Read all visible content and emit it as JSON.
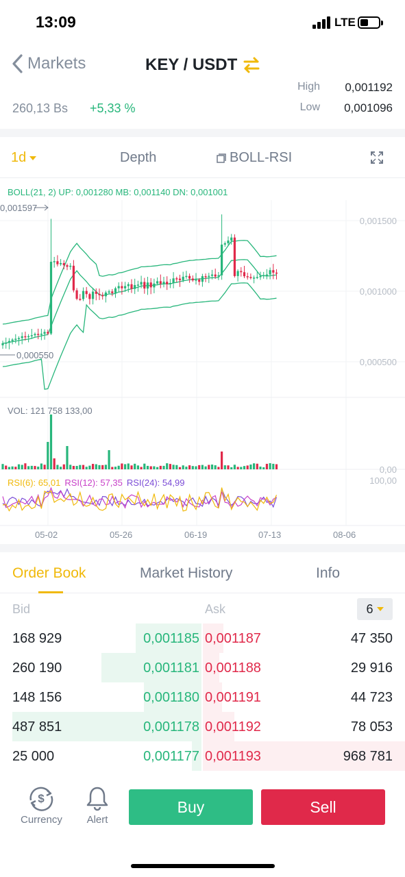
{
  "status_bar": {
    "time": "13:09",
    "carrier": "LTE"
  },
  "nav": {
    "back_label": "Markets",
    "pair": "KEY / USDT"
  },
  "price": {
    "local_value": "260,13 Bs",
    "change": "+5,33 %",
    "high_label": "High",
    "high_value": "0,001192",
    "low_label": "Low",
    "low_value": "0,001096"
  },
  "chart_tabs": {
    "interval": "1d",
    "depth": "Depth",
    "indicator": "BOLL-RSI"
  },
  "chart": {
    "boll_legend": "BOLL(21, 2) UP: 0,001280 MB: 0,001140 DN: 0,001001",
    "vol_legend": "VOL: 121 758 133,00",
    "rsi6": "RSI(6): 65,01",
    "rsi12": "RSI(12): 57,35",
    "rsi24": "RSI(24): 54,99",
    "y_ticks": [
      "0,001500",
      "0,001000",
      "0,000500"
    ],
    "vol_zero": "0,00",
    "rsi_top": "100,00",
    "high_marker": "0,001597",
    "low_marker": "0,000550",
    "x_ticks": [
      "05-02",
      "05-26",
      "06-19",
      "07-13",
      "08-06"
    ]
  },
  "orderbook": {
    "tabs": [
      "Order Book",
      "Market History",
      "Info"
    ],
    "bid_label": "Bid",
    "ask_label": "Ask",
    "precision": "6",
    "rows": [
      {
        "bid_qty": "168 929",
        "bid_price": "0,001185",
        "ask_price": "0,001187",
        "ask_qty": "47 350"
      },
      {
        "bid_qty": "260 190",
        "bid_price": "0,001181",
        "ask_price": "0,001188",
        "ask_qty": "29 916"
      },
      {
        "bid_qty": "148 156",
        "bid_price": "0,001180",
        "ask_price": "0,001191",
        "ask_qty": "44 723"
      },
      {
        "bid_qty": "487 851",
        "bid_price": "0,001178",
        "ask_price": "0,001192",
        "ask_qty": "78 053"
      },
      {
        "bid_qty": "25 000",
        "bid_price": "0,001177",
        "ask_price": "0,001193",
        "ask_qty": "968 781"
      }
    ]
  },
  "bottom_bar": {
    "currency": "Currency",
    "alert": "Alert",
    "buy": "Buy",
    "sell": "Sell"
  },
  "colors": {
    "accent": "#f0b90b",
    "up": "#27b67b",
    "down": "#e0294a"
  }
}
